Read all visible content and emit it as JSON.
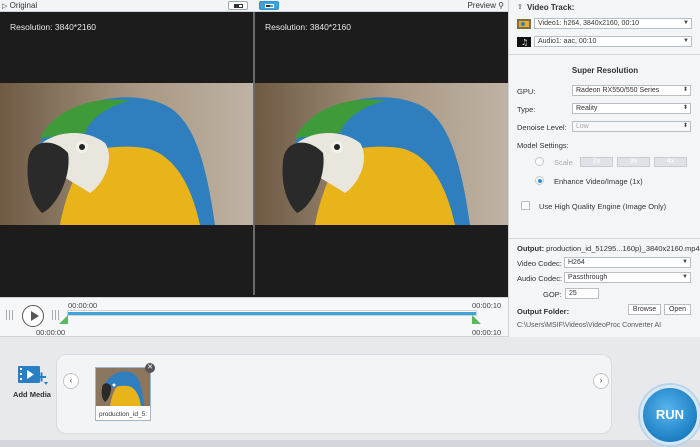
{
  "preview": {
    "tab_original": "Original",
    "tab_preview": "Preview",
    "left_resolution": "Resolution: 3840*2160",
    "right_resolution": "Resolution: 3840*2160"
  },
  "timeline": {
    "current_left_top": "00:00:00",
    "current_left_bottom": "00:00:00",
    "current_right_top": "00:00:10",
    "current_right_bottom": "00:00:10",
    "progress_fraction": 1.0
  },
  "panel": {
    "video_track_title": "Video Track:",
    "video_track_value": "Video1: h264, 3840x2160, 00:10",
    "audio_track_value": "Audio1: aac, 00:10",
    "super_resolution_title": "Super Resolution",
    "gpu_label": "GPU:",
    "gpu_value": "Radeon RX550/550 Series",
    "type_label": "Type:",
    "type_value": "Reality",
    "denoise_label": "Denoise Level:",
    "denoise_value": "Low",
    "model_settings_label": "Model Settings:",
    "scale_label": "Scale",
    "scale_options": [
      "2x",
      "3x",
      "4x"
    ],
    "enhance_label": "Enhance Video/Image (1x)",
    "hq_engine_label": "Use High Quality Engine (Image Only)",
    "output_label": "Output:",
    "output_value": "production_id_51295...160p)_3840x2160.mp4",
    "video_codec_label": "Video Codec:",
    "video_codec_value": "H264",
    "audio_codec_label": "Audio Codec:",
    "audio_codec_value": "Passthrough",
    "gop_label": "GOP:",
    "gop_value": "25",
    "output_folder_label": "Output Folder:",
    "browse_label": "Browse",
    "open_label": "Open",
    "folder_path": "C:\\Users\\MSIF\\Videos\\VideoProc Converter AI"
  },
  "bottom": {
    "add_media_label": "Add Media",
    "thumb_name": "production_id_5:",
    "run_label": "RUN"
  },
  "icons": {
    "compare_split": "split-view-icon",
    "compare_side": "side-by-side-icon",
    "preview_search": "magnifier-icon",
    "video_track": "film-icon",
    "audio_track": "music-icon",
    "add_media": "film-add-icon"
  },
  "colors": {
    "accent": "#2d8fd5",
    "run": "#1d7fc4",
    "progress": "#3fa3d8",
    "marker": "#5bb85b"
  }
}
